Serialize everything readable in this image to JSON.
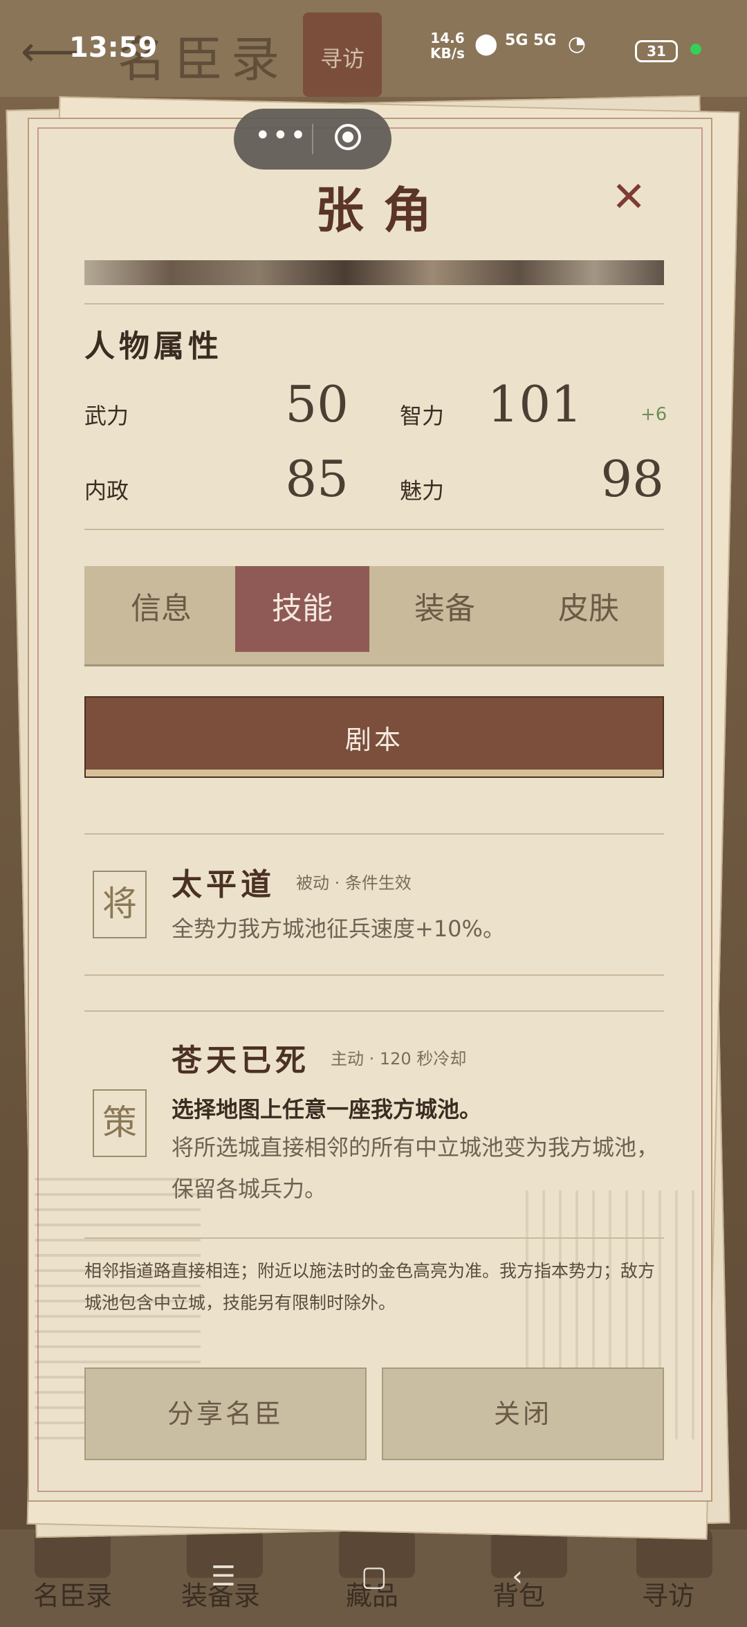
{
  "status_bar": {
    "time": "13:59",
    "net_speed_value": "14.6",
    "net_speed_unit": "KB/s",
    "signal": "5G 5G",
    "battery": "31"
  },
  "background": {
    "page_title": "名臣录",
    "active_tab": "寻访",
    "bottom_nav": [
      "名臣录",
      "装备录",
      "藏品",
      "背包",
      "寻访"
    ]
  },
  "hero": {
    "name": "张角"
  },
  "attributes": {
    "section_title": "人物属性",
    "items": [
      {
        "label": "武力",
        "value": "50",
        "bonus": ""
      },
      {
        "label": "智力",
        "value": "101",
        "bonus": "+6"
      },
      {
        "label": "内政",
        "value": "85",
        "bonus": ""
      },
      {
        "label": "魅力",
        "value": "98",
        "bonus": ""
      }
    ]
  },
  "tabs": [
    {
      "label": "信息",
      "active": false
    },
    {
      "label": "技能",
      "active": true
    },
    {
      "label": "装备",
      "active": false
    },
    {
      "label": "皮肤",
      "active": false
    }
  ],
  "script_button": "剧本",
  "skills": [
    {
      "badge": "将",
      "name": "太平道",
      "tag": "被动 · 条件生效",
      "desc_bold": "",
      "desc": "全势力我方城池征兵速度+10%。"
    },
    {
      "badge": "策",
      "name": "苍天已死",
      "tag": "主动 · 120 秒冷却",
      "desc_bold": "选择地图上任意一座我方城池。",
      "desc": "将所选城直接相邻的所有中立城池变为我方城池，保留各城兵力。"
    }
  ],
  "note": "相邻指道路直接相连；附近以施法时的金色高亮为准。我方指本势力；敌方城池包含中立城，技能另有限制时除外。",
  "footer": {
    "share": "分享名臣",
    "close": "关闭"
  },
  "colors": {
    "paper": "#ece2cb",
    "accent": "#8f5a55",
    "button_brown": "#7b4f3c",
    "title_red": "#5b3428"
  }
}
